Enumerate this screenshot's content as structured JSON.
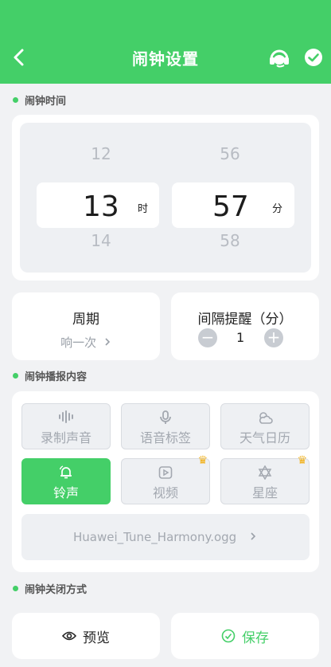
{
  "header": {
    "title": "闹钟设置",
    "back_icon": "chevron-left-icon",
    "support_icon": "headset-icon",
    "confirm_icon": "check-circle-icon"
  },
  "sections": {
    "time": "闹钟时间",
    "content": "闹钟播报内容",
    "close_method": "闹钟关闭方式"
  },
  "time_picker": {
    "hour_prev": "12",
    "hour": "13",
    "hour_next": "14",
    "hour_unit": "时",
    "minute_prev": "56",
    "minute": "57",
    "minute_next": "58",
    "minute_unit": "分"
  },
  "period": {
    "title": "周期",
    "value": "响一次"
  },
  "interval": {
    "title": "间隔提醒（分）",
    "value": "1",
    "minus": "−",
    "plus": "+"
  },
  "content_options": [
    {
      "label": "录制声音",
      "icon": "waveform-icon",
      "active": false,
      "premium": false
    },
    {
      "label": "语音标签",
      "icon": "microphone-icon",
      "active": false,
      "premium": false
    },
    {
      "label": "天气日历",
      "icon": "weather-icon",
      "active": false,
      "premium": false
    },
    {
      "label": "铃声",
      "icon": "bell-icon",
      "active": true,
      "premium": false
    },
    {
      "label": "视频",
      "icon": "video-icon",
      "active": false,
      "premium": true
    },
    {
      "label": "星座",
      "icon": "star-of-david-icon",
      "active": false,
      "premium": true
    }
  ],
  "ringtone_file": "Huawei_Tune_Harmony.ogg",
  "buttons": {
    "preview": "预览",
    "save": "保存"
  },
  "colors": {
    "accent": "#44cf68",
    "background": "#f1f2f4",
    "crown": "#f2b21d"
  }
}
